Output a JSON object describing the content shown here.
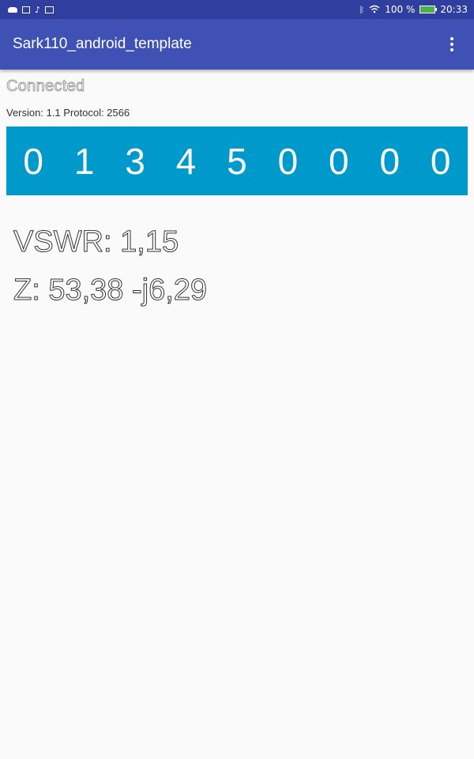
{
  "status_bar": {
    "left_icons": [
      "cloud-icon",
      "grid-icon",
      "music-note-icon",
      "mail-icon"
    ],
    "right_icons": [
      "bluetooth-icon",
      "wifi-icon",
      "battery-icon"
    ],
    "battery_percent": "100 %",
    "time": "20:33",
    "colors": {
      "background": "#303f9f",
      "battery": "#4caf50"
    }
  },
  "app_bar": {
    "title": "Sark110_android_template",
    "overflow_icon": "more-vert-icon",
    "color": "#3f51b5"
  },
  "connection": {
    "status": "Connected",
    "version_line": "Version: 1.1 Protocol: 2566"
  },
  "frequency": {
    "digits": [
      "0",
      "1",
      "3",
      "4",
      "5",
      "0",
      "0",
      "0",
      "0"
    ],
    "panel_color": "#0099cc"
  },
  "measurements": {
    "vswr": "VSWR: 1,15",
    "impedance": "Z: 53,38 -j6,29"
  }
}
